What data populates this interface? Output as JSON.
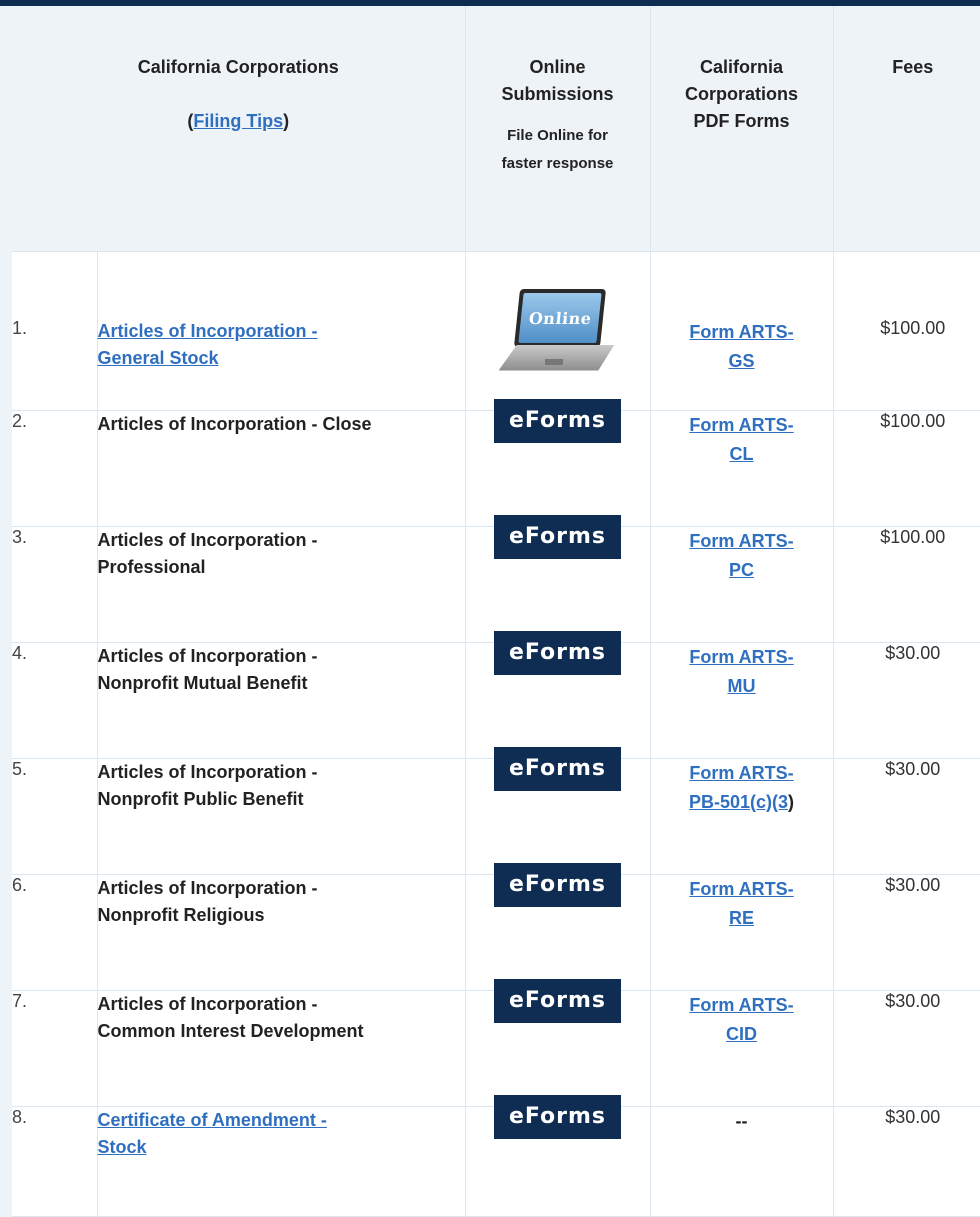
{
  "header": {
    "title": "California Corporations",
    "tips_open": "(",
    "tips_link": "Filing Tips",
    "tips_close": ")",
    "online_title_1": "Online",
    "online_title_2": "Submissions",
    "online_note_1": "File Online for",
    "online_note_2": "faster response",
    "pdf_title_1": "California",
    "pdf_title_2": "Corporations",
    "pdf_title_3": "PDF Forms",
    "fees_title": "Fees"
  },
  "rows": [
    {
      "num": "1.",
      "name_1": "Articles of Incorporation -",
      "name_2": "General Stock",
      "name_is_link": true,
      "online": "laptop-online-icon",
      "online_label": "Online",
      "pdf_1": "Form ARTS-",
      "pdf_2": "GS",
      "fee": "$100.00"
    },
    {
      "num": "2.",
      "name_1": "Articles of Incorporation - Close",
      "name_2": "",
      "name_is_link": false,
      "online": "eForms",
      "pdf_1": "Form ARTS-",
      "pdf_2": "CL",
      "fee": "$100.00"
    },
    {
      "num": "3.",
      "name_1": "Articles of Incorporation -",
      "name_2": "Professional",
      "name_is_link": false,
      "online": "eForms",
      "pdf_1": "Form ARTS-",
      "pdf_2": "PC",
      "fee": "$100.00"
    },
    {
      "num": "4.",
      "name_1": "Articles of Incorporation -",
      "name_2": "Nonprofit Mutual Benefit",
      "name_is_link": false,
      "online": "eForms",
      "pdf_1": "Form ARTS-",
      "pdf_2": "MU",
      "fee": "$30.00"
    },
    {
      "num": "5.",
      "name_1": "Articles of Incorporation -",
      "name_2": "Nonprofit Public Benefit",
      "name_is_link": false,
      "online": "eForms",
      "pdf_1": "Form ARTS-",
      "pdf_2": "PB-501(c)(3",
      "pdf_tail": ")",
      "fee": "$30.00"
    },
    {
      "num": "6.",
      "name_1": "Articles of Incorporation -",
      "name_2": "Nonprofit Religious",
      "name_is_link": false,
      "online": "eForms",
      "pdf_1": "Form ARTS-",
      "pdf_2": "RE",
      "fee": "$30.00"
    },
    {
      "num": "7.",
      "name_1": "Articles of Incorporation -",
      "name_2": "Common Interest Development",
      "name_is_link": false,
      "online": "eForms",
      "pdf_1": "Form ARTS-",
      "pdf_2": "CID",
      "fee": "$30.00"
    },
    {
      "num": "8.",
      "name_1": "Certificate of Amendment -",
      "name_2": "Stock",
      "name_is_link": true,
      "online": "eForms",
      "pdf_dash": "--",
      "fee": "$30.00"
    }
  ],
  "colors": {
    "navy": "#0f2d52",
    "link": "#2f6fbf",
    "header_bg": "#eef3f8"
  }
}
